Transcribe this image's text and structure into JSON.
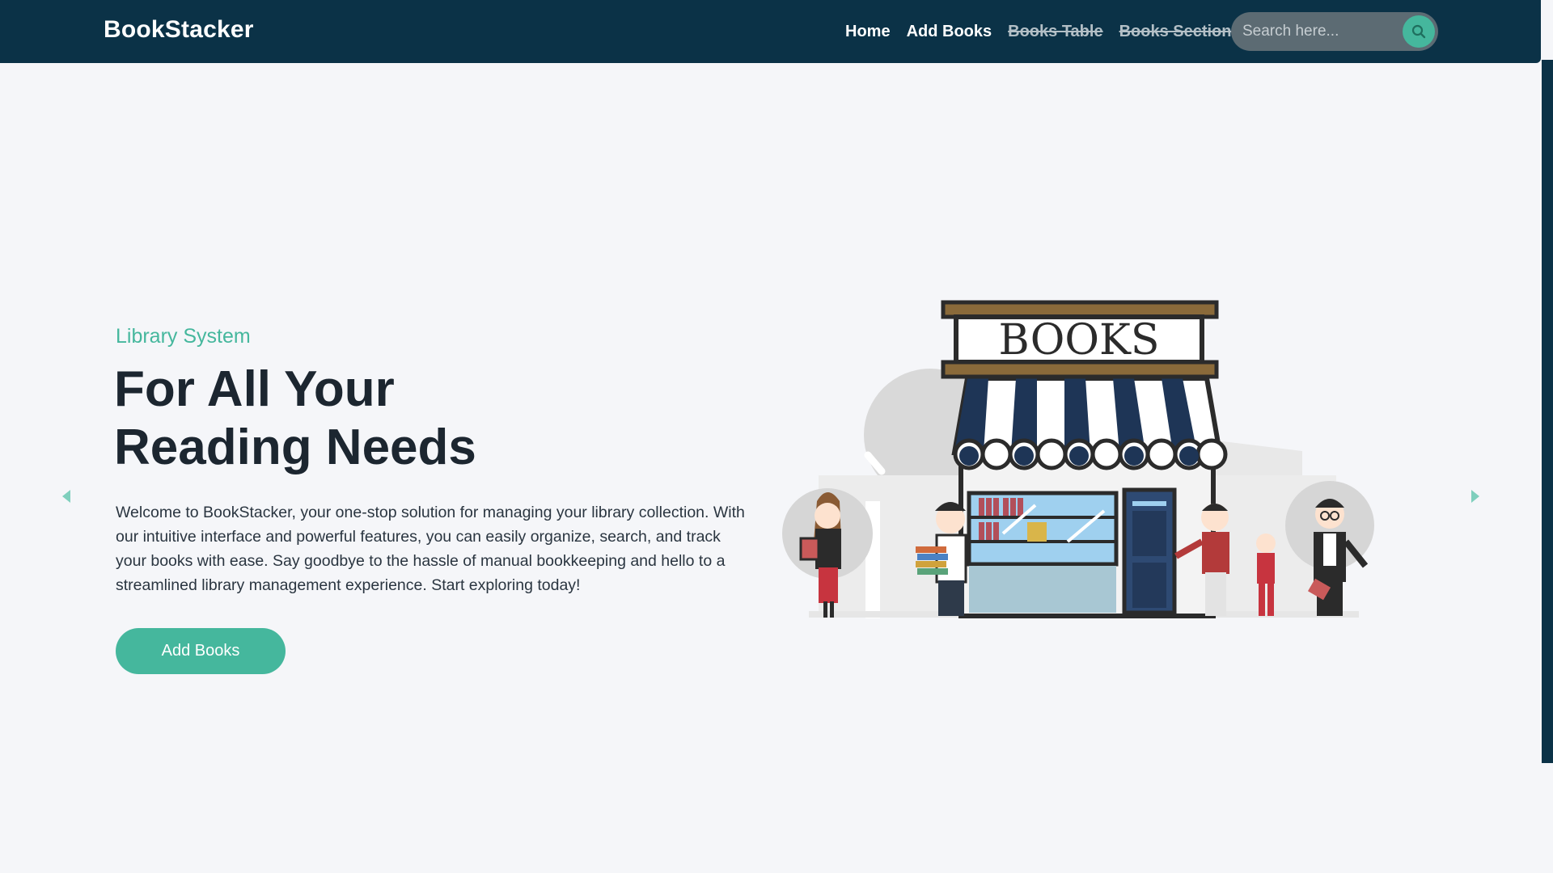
{
  "navbar": {
    "brand": "BookStacker",
    "links": [
      {
        "label": "Home",
        "disabled": false
      },
      {
        "label": "Add Books",
        "disabled": false
      },
      {
        "label": "Books Table",
        "disabled": true
      },
      {
        "label": "Books Section",
        "disabled": true
      }
    ],
    "search": {
      "placeholder": "Search here...",
      "icon": "search-icon"
    }
  },
  "hero": {
    "kicker": "Library System",
    "headline_line1": "For All Your",
    "headline_line2": "Reading Needs",
    "description": "Welcome to BookStacker, your one-stop solution for managing your library collection. With our intuitive interface and powerful features, you can easily organize, search, and track your books with ease. Say goodbye to the hassle of manual bookkeeping and hello to a streamlined library management experience. Start exploring today!",
    "cta_label": "Add Books",
    "illustration": {
      "sign_text": "BOOKS",
      "icon": "bookstore-illustration"
    }
  },
  "carousel": {
    "prev_icon": "caret-left-icon",
    "next_icon": "caret-right-icon"
  },
  "colors": {
    "navbar_bg": "#0b3247",
    "accent": "#45b79d",
    "page_bg": "#f5f6f9",
    "text_dark": "#1c2630",
    "awning_navy": "#1e3556"
  }
}
